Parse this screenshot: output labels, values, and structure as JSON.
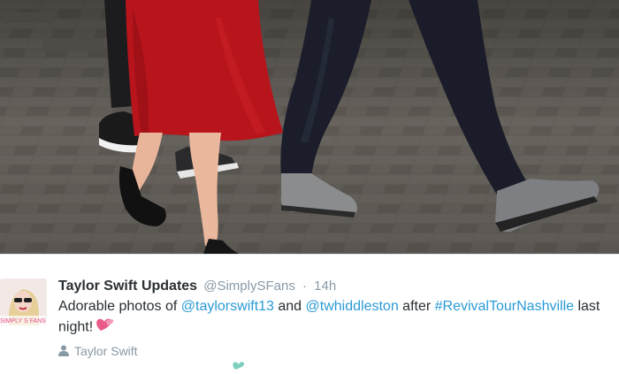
{
  "photo": {
    "description_icon": "photo-of-couple-walking"
  },
  "tweet": {
    "display_name": "Taylor Swift Updates",
    "handle": "@SimplySFans",
    "separator": "·",
    "time": "14h",
    "text_prefix": "Adorable photos of ",
    "mention1": "@taylorswift13",
    "text_mid": " and ",
    "mention2": "@twhiddleston",
    "text_after": " after ",
    "hashtag": "#RevivalTourNashville",
    "text_suffix": " last night!",
    "emoji_icon": "two-hearts-icon",
    "context_label": "Taylor Swift",
    "colors": {
      "link": "#2b9bd5",
      "name": "#292f33",
      "meta": "#8899a6",
      "heart": "#ea5b8a"
    }
  }
}
